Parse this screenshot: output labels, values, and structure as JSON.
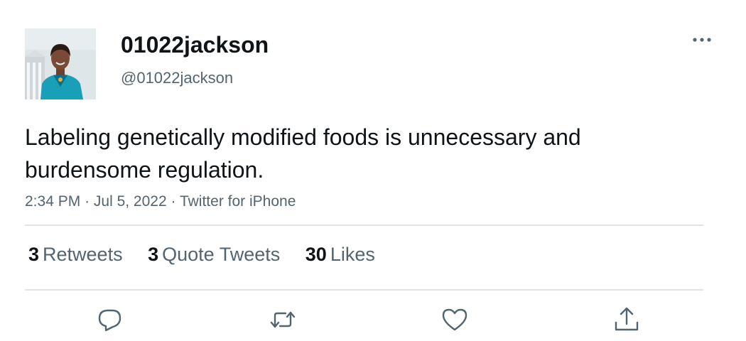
{
  "user": {
    "display_name": "01022jackson",
    "handle": "@01022jackson"
  },
  "tweet": {
    "text": "Labeling genetically modified foods is unnecessary and burdensome regulation.",
    "time": "2:34 PM",
    "date": "Jul 5, 2022",
    "source": "Twitter for iPhone",
    "separator": "·"
  },
  "stats": {
    "retweets": {
      "count": "3",
      "label": "Retweets"
    },
    "quote_tweets": {
      "count": "3",
      "label": "Quote Tweets"
    },
    "likes": {
      "count": "30",
      "label": "Likes"
    }
  },
  "icons": {
    "more": "more-horizontal-icon",
    "reply": "reply-icon",
    "retweet": "retweet-icon",
    "like": "heart-icon",
    "share": "share-icon"
  },
  "colors": {
    "text_primary": "#0f1419",
    "text_secondary": "#536471",
    "divider": "#e1e4e7",
    "icon": "#536471"
  }
}
